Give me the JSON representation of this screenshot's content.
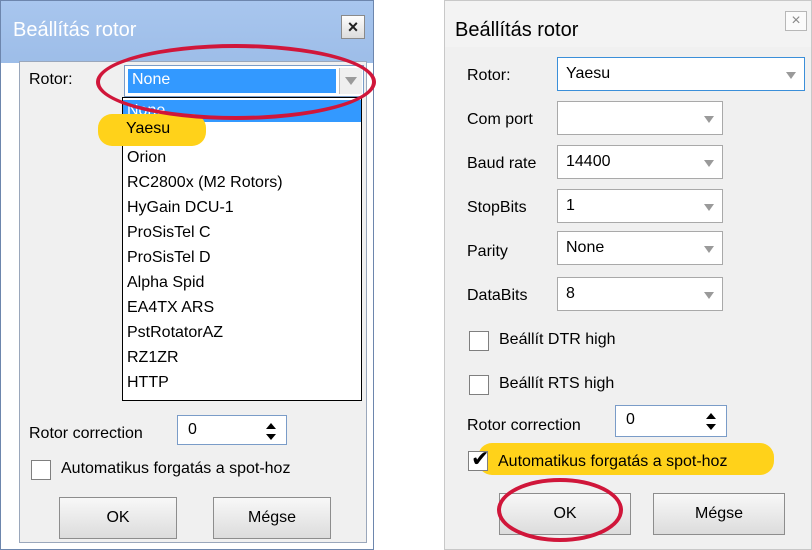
{
  "left_dialog": {
    "title": "Beállítás rotor",
    "close_glyph": "×",
    "rotor_label": "Rotor:",
    "rotor_selected": "None",
    "rotor_options": [
      "None",
      "Yaesu",
      "Orion",
      "RC2800x (M2 Rotors)",
      "HyGain DCU-1",
      "ProSisTel C",
      "ProSisTel D",
      "Alpha Spid",
      "EA4TX ARS",
      "PstRotatorAZ",
      "RZ1ZR",
      "HTTP"
    ],
    "rotor_correction_label": "Rotor correction",
    "rotor_correction_value": "0",
    "auto_rotate_label": "Automatikus forgatás a spot-hoz",
    "auto_rotate_checked": false,
    "ok_label": "OK",
    "cancel_label": "Mégse"
  },
  "right_dialog": {
    "title": "Beállítás rotor",
    "close_glyph": "×",
    "rotor_label": "Rotor:",
    "rotor_value": "Yaesu",
    "com_port_label": "Com port",
    "com_port_value": "",
    "baud_rate_label": "Baud rate",
    "baud_rate_value": "14400",
    "stopbits_label": "StopBits",
    "stopbits_value": "1",
    "parity_label": "Parity",
    "parity_value": "None",
    "databits_label": "DataBits",
    "databits_value": "8",
    "dtr_label": "Beállít DTR high",
    "dtr_checked": false,
    "rts_label": "Beállít RTS high",
    "rts_checked": false,
    "rotor_correction_label": "Rotor correction",
    "rotor_correction_value": "0",
    "auto_rotate_label": "Automatikus forgatás a spot-hoz",
    "auto_rotate_checked": true,
    "check_glyph": "✔",
    "ok_label": "OK",
    "cancel_label": "Mégse"
  },
  "colors": {
    "annotation_circle": "#d0163a",
    "annotation_highlight": "#ffd21a",
    "selection_blue": "#3399ff"
  }
}
